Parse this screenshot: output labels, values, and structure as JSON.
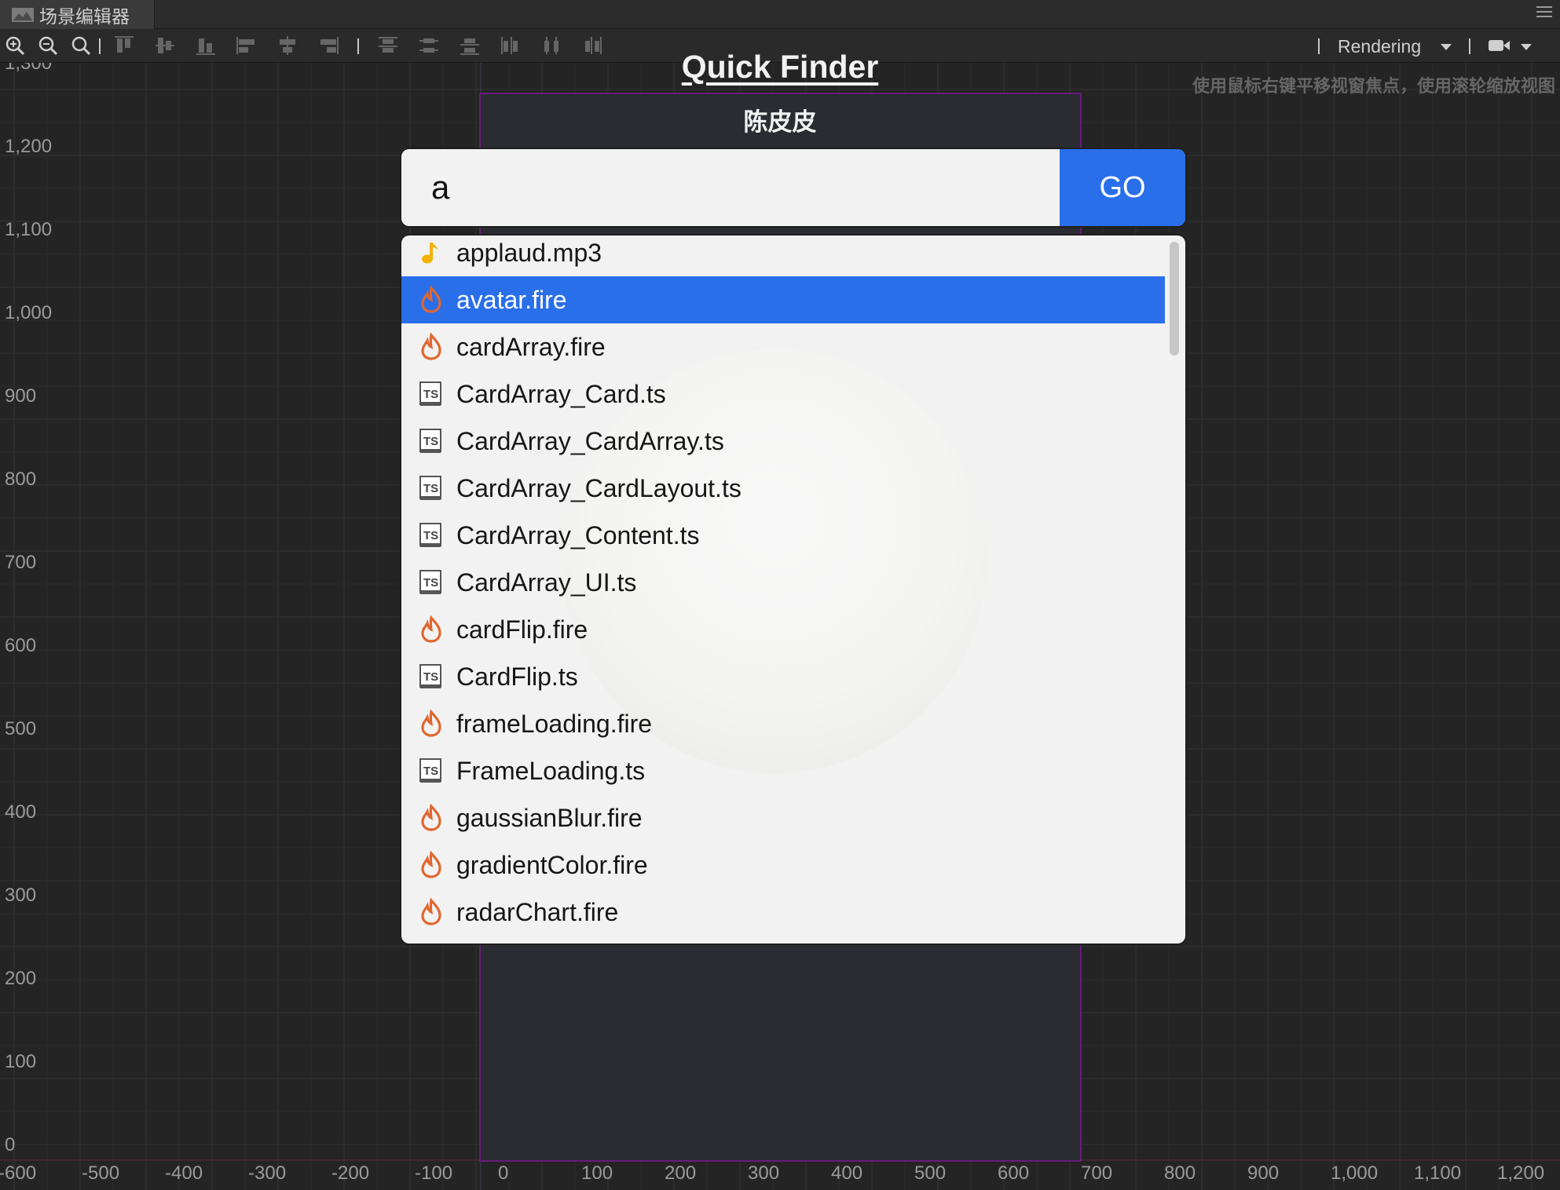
{
  "tabbar": {
    "title": "场景编辑器"
  },
  "toolbar": {
    "render_mode": "Rendering"
  },
  "viewport": {
    "hint": "使用鼠标右键平移视窗焦点，使用滚轮缩放视图",
    "y_axis_labels": [
      "1,300",
      "1,200",
      "1,100",
      "1,000",
      "900",
      "800",
      "700",
      "600",
      "500",
      "400",
      "300",
      "200",
      "100",
      "0"
    ],
    "x_axis_labels": [
      "-600",
      "-500",
      "-400",
      "-300",
      "-200",
      "-100",
      "0",
      "100",
      "200",
      "300",
      "400",
      "500",
      "600",
      "700",
      "800",
      "900",
      "1,000",
      "1,100",
      "1,200"
    ]
  },
  "app": {
    "title": "Quick Finder",
    "subtitle": "陈皮皮",
    "search": {
      "value": "a",
      "go_label": "GO"
    },
    "results": [
      {
        "label": "applaud.mp3",
        "icon": "music-note-icon",
        "selected": false
      },
      {
        "label": "avatar.fire",
        "icon": "fire-icon",
        "selected": true
      },
      {
        "label": "cardArray.fire",
        "icon": "fire-icon",
        "selected": false
      },
      {
        "label": "CardArray_Card.ts",
        "icon": "typescript-file-icon",
        "selected": false
      },
      {
        "label": "CardArray_CardArray.ts",
        "icon": "typescript-file-icon",
        "selected": false
      },
      {
        "label": "CardArray_CardLayout.ts",
        "icon": "typescript-file-icon",
        "selected": false
      },
      {
        "label": "CardArray_Content.ts",
        "icon": "typescript-file-icon",
        "selected": false
      },
      {
        "label": "CardArray_UI.ts",
        "icon": "typescript-file-icon",
        "selected": false
      },
      {
        "label": "cardFlip.fire",
        "icon": "fire-icon",
        "selected": false
      },
      {
        "label": "CardFlip.ts",
        "icon": "typescript-file-icon",
        "selected": false
      },
      {
        "label": "frameLoading.fire",
        "icon": "fire-icon",
        "selected": false
      },
      {
        "label": "FrameLoading.ts",
        "icon": "typescript-file-icon",
        "selected": false
      },
      {
        "label": "gaussianBlur.fire",
        "icon": "fire-icon",
        "selected": false
      },
      {
        "label": "gradientColor.fire",
        "icon": "fire-icon",
        "selected": false
      },
      {
        "label": "radarChart.fire",
        "icon": "fire-icon",
        "selected": false
      }
    ]
  },
  "colors": {
    "accent": "#2a6fea",
    "selection_text": "#ffffff",
    "fire": "#e0672f",
    "music": "#f2b300"
  }
}
